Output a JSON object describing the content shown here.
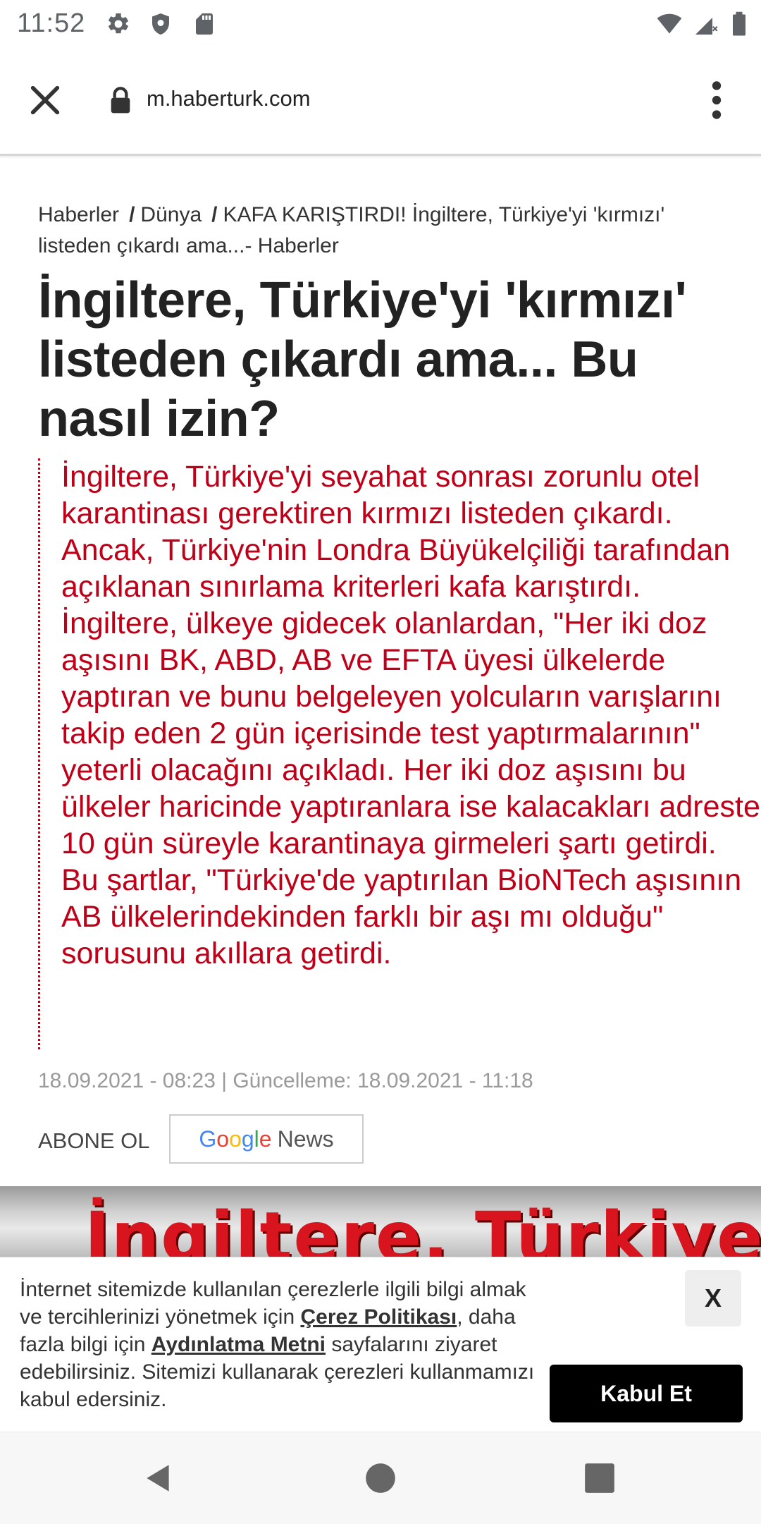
{
  "status_bar": {
    "time": "11:52"
  },
  "browser": {
    "url": "m.haberturk.com"
  },
  "breadcrumb": {
    "items": [
      "Haberler",
      "Dünya"
    ],
    "current": "KAFA KARIŞTIRDI! İngiltere, Türkiye'yi 'kırmızı' listeden çıkardı ama...- Haberler"
  },
  "article": {
    "headline": "İngiltere, Türkiye'yi 'kırmızı' listeden çıkardı ama... Bu nasıl izin?",
    "spot": "İngiltere, Türkiye'yi seyahat sonrası zorunlu otel karantinası gerektiren kırmızı listeden çıkardı. Ancak, Türkiye'nin Londra Büyükelçiliği tarafından açıklanan sınırlama kriterleri kafa karıştırdı. İngiltere, ülkeye gidecek olanlardan, \"Her iki doz aşısını BK, ABD, AB ve EFTA üyesi ülkelerde yaptıran ve bunu belgeleyen yolcuların varışlarını takip eden 2 gün içerisinde test yaptırmalarının\" yeterli olacağını açıkladı. Her iki doz aşısını bu ülkeler haricinde yaptıranlara ise kalacakları adreste 10 gün süreyle karantinaya girmeleri şartı getirdi. Bu şartlar, \"Türkiye'de yaptırılan BioNTech aşısının AB ülkelerindekinden farklı bir aşı mı olduğu\" sorusunu akıllara getirdi.",
    "dates": "18.09.2021 - 08:23 | Güncelleme: 18.09.2021 - 11:18",
    "subscribe_label": "ABONE OL",
    "google_news": {
      "g1": "G",
      "g2": "o",
      "g3": "o",
      "g4": "g",
      "g5": "l",
      "g6": "e",
      "news": "News"
    },
    "hero_text": "İngiltere, Türkiye'yi"
  },
  "cookie_banner": {
    "text_1": "İnternet sitemizde kullanılan çerezlerle ilgili bilgi almak ve tercihlerinizi yönetmek için ",
    "link_1": "Çerez Politikası",
    "text_2": ", daha fazla bilgi için ",
    "link_2": "Aydınlatma Metni",
    "text_3": " sayfalarını ziyaret edebilirsiniz. Sitemizi kullanarak çerezleri kullanmamızı kabul edersiniz.",
    "close_label": "X",
    "accept_label": "Kabul Et"
  },
  "colors": {
    "accent_red": "#c00018",
    "headline": "#222222",
    "muted": "#9a9a9a"
  }
}
